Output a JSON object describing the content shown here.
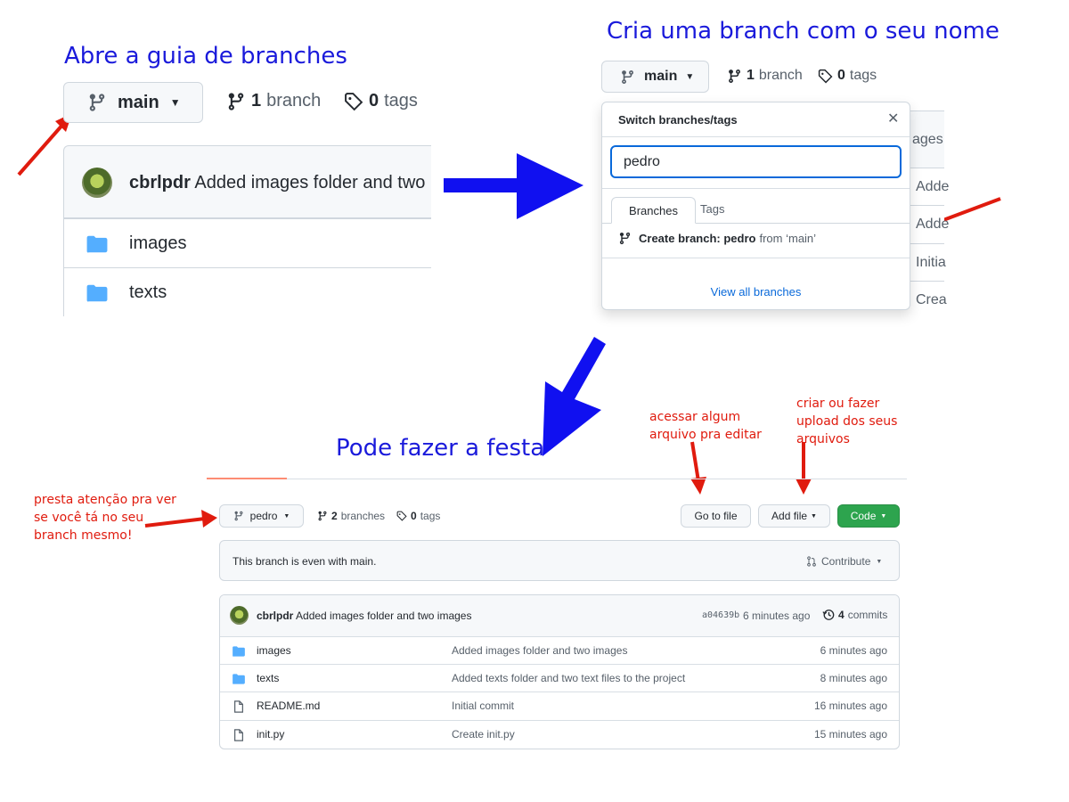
{
  "headings": {
    "step1": "Abre a guia de branches",
    "step2": "Cria uma branch com o seu nome",
    "step3": "Pode fazer a festa"
  },
  "notes": {
    "check_branch": "presta atenção pra ver se você tá no seu branch mesmo!",
    "goto_file": "acessar algum arquivo pra editar",
    "add_file": "criar ou fazer upload dos seus arquivos"
  },
  "panel1": {
    "branch_button": "main",
    "branch_count": "1",
    "branch_word": "branch",
    "tag_count": "0",
    "tag_word": "tags",
    "commit_author": "cbrlpdr",
    "commit_message": "Added images folder and two images",
    "rows": [
      {
        "name": "images"
      },
      {
        "name": "texts"
      }
    ]
  },
  "panel2": {
    "branch_button": "main",
    "branch_count": "1",
    "branch_word": "branch",
    "tag_count": "0",
    "tag_word": "tags",
    "dropdown_title": "Switch branches/tags",
    "search_value": "pedro",
    "tabs": [
      "Branches",
      "Tags"
    ],
    "create_prefix": "Create branch: pedro",
    "create_suffix": "from ‘main’",
    "view_all": "View all branches",
    "behind_rows": [
      "ages",
      "Adde",
      "Adde",
      "Initia",
      "Crea"
    ]
  },
  "panel3": {
    "branch_button": "pedro",
    "branch_count": "2",
    "branch_word": "branches",
    "tag_count": "0",
    "tag_word": "tags",
    "goto_file": "Go to file",
    "add_file": "Add file",
    "code": "Code",
    "even_message": "This branch is even with main.",
    "contribute": "Contribute",
    "commit_author": "cbrlpdr",
    "commit_message": "Added images folder and two images",
    "commit_hash": "a04639b",
    "commit_time": "6 minutes ago",
    "commit_count": "4",
    "commit_word": "commits",
    "files": [
      {
        "name": "images",
        "type": "folder",
        "message": "Added images folder and two images",
        "time": "6 minutes ago"
      },
      {
        "name": "texts",
        "type": "folder",
        "message": "Added texts folder and two text files to the project",
        "time": "8 minutes ago"
      },
      {
        "name": "README.md",
        "type": "file",
        "message": "Initial commit",
        "time": "16 minutes ago"
      },
      {
        "name": "init.py",
        "type": "file",
        "message": "Create init.py",
        "time": "15 minutes ago"
      }
    ]
  },
  "colors": {
    "heading_blue": "#1a1adb",
    "annotation_red": "#e01b0e",
    "code_green": "#2da44e",
    "folder_blue": "#54aeff",
    "link_blue": "#0969da"
  },
  "icons": [
    "git-branch-icon",
    "tag-icon",
    "caret-down-icon",
    "folder-icon",
    "file-icon",
    "close-icon",
    "history-icon",
    "pull-request-icon",
    "avatar"
  ]
}
